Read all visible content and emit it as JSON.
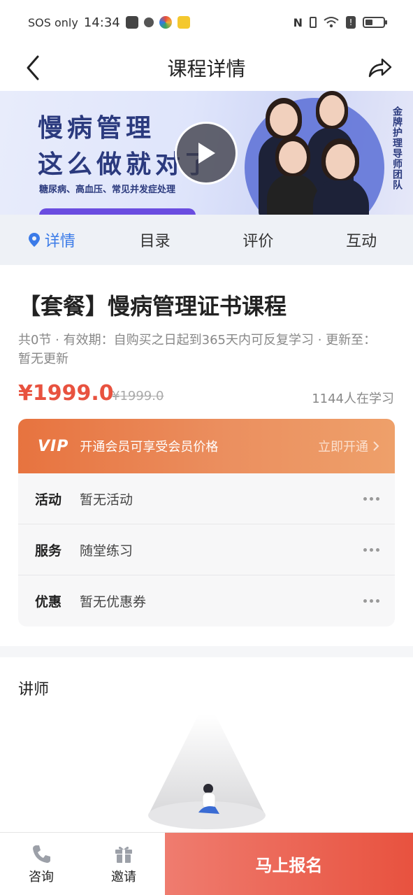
{
  "status_bar": {
    "carrier": "SOS only",
    "time": "14:34",
    "battery_level": 0.35
  },
  "nav": {
    "title": "课程详情",
    "back_icon": "chevron-left-icon",
    "share_icon": "share-icon"
  },
  "banner": {
    "line1": "慢病管理",
    "line2": "这么做就对了",
    "subtitle": "糖尿病、高血压、常见并发症处理",
    "side_text": "金牌护理导师团队"
  },
  "tabs": [
    {
      "label": "详情",
      "active": true
    },
    {
      "label": "目录",
      "active": false
    },
    {
      "label": "评价",
      "active": false
    },
    {
      "label": "互动",
      "active": false
    }
  ],
  "course": {
    "title": "【套餐】慢病管理证书课程",
    "meta": "共0节 · 有效期：自购买之日起到365天内可反复学习 · 更新至：暂无更新",
    "price": "¥1999.0",
    "original_price": "¥1999.0",
    "learners": "1144人在学习"
  },
  "vip": {
    "tag": "VIP",
    "text": "开通会员可享受会员价格",
    "action": "立即开通"
  },
  "rows": [
    {
      "label": "活动",
      "value": "暂无活动"
    },
    {
      "label": "服务",
      "value": "随堂练习"
    },
    {
      "label": "优惠",
      "value": "暂无优惠券"
    }
  ],
  "lecturer": {
    "title": "讲师"
  },
  "bottom": {
    "consult": "咨询",
    "invite": "邀请",
    "enroll": "马上报名"
  },
  "colors": {
    "accent_blue": "#3b7be8",
    "price_red": "#e8523f",
    "vip_orange": "#e7733f"
  }
}
